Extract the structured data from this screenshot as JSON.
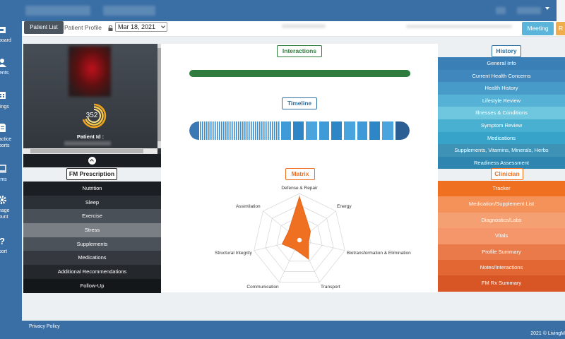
{
  "sidebar": {
    "items": [
      {
        "label": "board",
        "icon": "dashboard-icon"
      },
      {
        "label": "ents",
        "icon": "patients-icon"
      },
      {
        "label": "tings",
        "icon": "meetings-icon"
      },
      {
        "label": "actice",
        "label2": "ports",
        "icon": "practice-reports-icon"
      },
      {
        "label": "rms",
        "icon": "forms-icon"
      },
      {
        "label": "nage",
        "label2": "ount",
        "icon": "gear-icon"
      },
      {
        "label": "port",
        "icon": "help-icon"
      }
    ]
  },
  "subheader": {
    "patient_list": "Patient List",
    "patient_profile": "Patient Profile",
    "date": "Mar 18, 2021",
    "meeting": "Meeting",
    "orange_btn": "R"
  },
  "patient": {
    "score": "352",
    "id_label": "Patient Id :"
  },
  "sections": {
    "interactions": "Interactions",
    "timeline": "Timeline",
    "history": "History",
    "fm_prescription": "FM Prescription",
    "matrix": "Matrix",
    "clinician": "Clinician"
  },
  "history_items": [
    "General Info",
    "Current Health Concerns",
    "Health History",
    "Lifestyle Review",
    "Illnesses & Conditions",
    "Symptom Review",
    "Medications",
    "Supplements, Vitamins, Minerals, Herbs",
    "Readiness Assessment"
  ],
  "fm_items": [
    "Nutrition",
    "Sleep",
    "Exercise",
    "Stress",
    "Supplements",
    "Medications",
    "Additional Recommendations",
    "Follow-Up"
  ],
  "clinician_items": [
    "Tracker",
    "Medication/Supplement List",
    "Diagnostics/Labs",
    "Vitals",
    "Profile Summary",
    "Notes/Interactions",
    "FM Rx Summary"
  ],
  "matrix": {
    "labels": [
      "Defense & Repair",
      "Energy",
      "Biotransformation & Elimination",
      "Transport",
      "Communication",
      "Structural Integrity",
      "Assimilation"
    ]
  },
  "colors": {
    "brand_blue": "#3a6fa5",
    "green": "#2e7d3f",
    "matrix_orange": "#f07022"
  },
  "footer": {
    "privacy": "Privacy Policy",
    "copyright": "2021 © LivingM"
  }
}
